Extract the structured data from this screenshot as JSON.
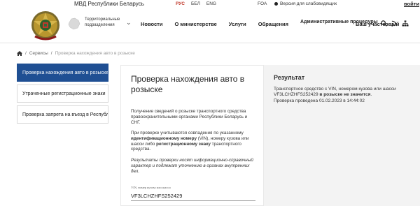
{
  "topbar": {
    "site_name": "МВД Республики Беларусь",
    "languages": [
      {
        "code": "РУС",
        "active": true
      },
      {
        "code": "БЕЛ",
        "active": false
      },
      {
        "code": "ENG",
        "active": false
      }
    ],
    "fda": "FOA",
    "accessibility": "Версия для слабовидящих",
    "login": "войти"
  },
  "header": {
    "region_label": "Территориальные подразделения",
    "nav": [
      {
        "label": "Новости"
      },
      {
        "label": "О министерстве"
      },
      {
        "label": "Услуги"
      },
      {
        "label": "Обращения"
      },
      {
        "label": "Административные процедуры"
      },
      {
        "label": "Ваш участковый"
      }
    ],
    "icons": [
      "search-icon",
      "rss-icon",
      "sitemap-icon"
    ]
  },
  "breadcrumb": {
    "items": [
      "Сервисы",
      "Проверка нахождения авто в розыске"
    ]
  },
  "sidebar": {
    "items": [
      {
        "label": "Проверка нахождения авто в розыске",
        "active": true
      },
      {
        "label": "Утраченные регистрационные знаки",
        "active": false
      },
      {
        "label": "Проверка запрета на въезд в Республику Беларусь",
        "active": false
      }
    ]
  },
  "main": {
    "title": "Проверка нахождения авто в розыске",
    "p1": "Получение сведений о розыске транспортного средства правоохранительными органами Республики Беларусь и СНГ.",
    "p2": "При проверке учитываются совпадения по указанному идентификационному номеру (VIN), номеру кузова или шасси либо регистрационному знаку транспортного средства.",
    "p3": "Результаты проверки носят информационно-справочный характер и подлежат уточнению в органах внутренних дел.",
    "input_label": "VIN, номер кузова или шасси",
    "input_value": "VF3LCHZHFS252429"
  },
  "result": {
    "title": "Результат",
    "line1": "Транспортное средство с VIN, номером кузова или шасси",
    "vin": "VF3LCHZHFS252429",
    "status": "в розыске не значится",
    "checked": "Проверка проведена 01.02.2023 в 14:44:02"
  },
  "colors": {
    "accent": "#1f4f93",
    "active_lang": "#c0392b",
    "result_bg": "#f3f3f3"
  }
}
